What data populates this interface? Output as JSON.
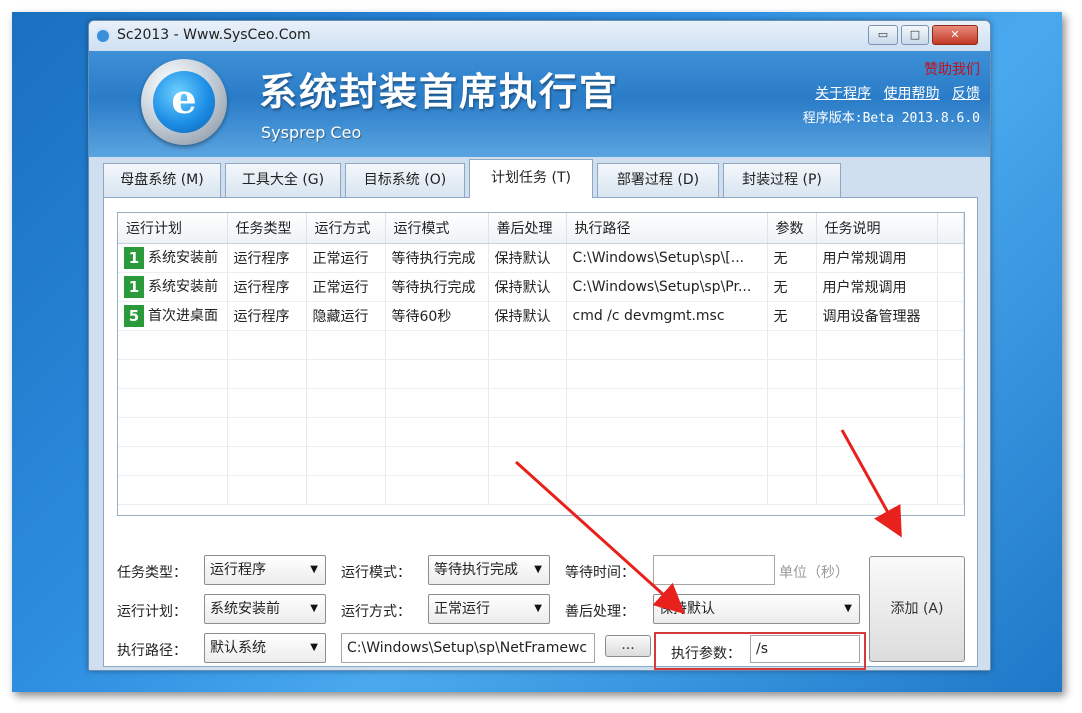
{
  "window": {
    "title": "Sc2013 - Www.SysCeo.Com",
    "min_label": "▭",
    "max_label": "□",
    "close_label": "✕"
  },
  "header": {
    "logo_letter": "e",
    "app_title": "系统封装首席执行官",
    "app_subtitle": "Sysprep Ceo",
    "sponsor": "赞助我们",
    "links": [
      "关于程序",
      "使用帮助",
      "反馈"
    ],
    "version": "程序版本:Beta 2013.8.6.0"
  },
  "tabs": [
    {
      "label": "母盘系统 (M)"
    },
    {
      "label": "工具大全 (G)"
    },
    {
      "label": "目标系统 (O)"
    },
    {
      "label": "计划任务 (T)"
    },
    {
      "label": "部署过程 (D)"
    },
    {
      "label": "封装过程 (P)"
    }
  ],
  "active_tab": "计划任务 (T)",
  "table": {
    "columns": [
      "运行计划",
      "任务类型",
      "运行方式",
      "运行模式",
      "善后处理",
      "执行路径",
      "参数",
      "任务说明"
    ],
    "rows": [
      {
        "order": "1",
        "plan": "系统安装前",
        "type": "运行程序",
        "method": "正常运行",
        "mode": "等待执行完成",
        "after": "保持默认",
        "path": "C:\\Windows\\Setup\\sp\\[...",
        "param": "无",
        "desc": "用户常规调用"
      },
      {
        "order": "1",
        "plan": "系统安装前",
        "type": "运行程序",
        "method": "正常运行",
        "mode": "等待执行完成",
        "after": "保持默认",
        "path": "C:\\Windows\\Setup\\sp\\Pr...",
        "param": "无",
        "desc": "用户常规调用"
      },
      {
        "order": "5",
        "plan": "首次进桌面",
        "type": "运行程序",
        "method": "隐藏运行",
        "mode": "等待60秒",
        "after": "保持默认",
        "path": "cmd /c devmgmt.msc",
        "param": "无",
        "desc": "调用设备管理器"
      }
    ]
  },
  "form": {
    "task_type_label": "任务类型：",
    "task_type_value": "运行程序",
    "run_mode_label": "运行模式：",
    "run_mode_value": "等待执行完成",
    "wait_time_label": "等待时间：",
    "wait_time_value": "",
    "unit_label": "单位（秒）",
    "run_plan_label": "运行计划：",
    "run_plan_value": "系统安装前",
    "run_method_label": "运行方式：",
    "run_method_value": "正常运行",
    "after_label": "善后处理：",
    "after_value": "保持默认",
    "exec_path_label": "执行路径：",
    "exec_path_value": "默认系统",
    "path_value": "C:\\Windows\\Setup\\sp\\NetFramewc",
    "browse_label": "...",
    "param_label": "执行参数：",
    "param_value": "/s",
    "add_button": "添加 (A)"
  },
  "colors": {
    "accent": "#2a7cc8",
    "order_badge": "#2a9a3a",
    "highlight": "#d33a3a"
  }
}
